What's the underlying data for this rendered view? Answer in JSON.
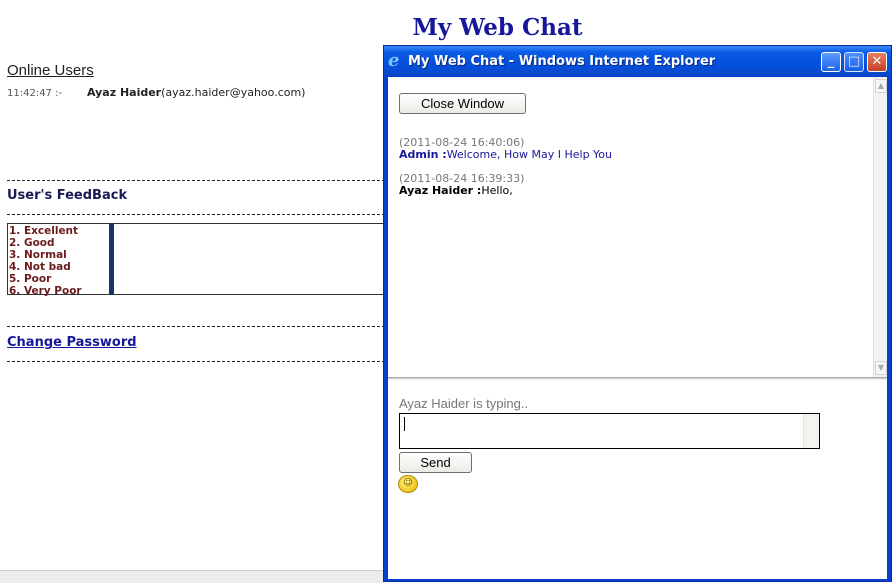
{
  "page": {
    "title": "My Web Chat"
  },
  "left": {
    "online_heading": "Online Users",
    "online_users": [
      {
        "time": "11:42:47 :-",
        "name": "Ayaz Haider",
        "email": "(ayaz.haider@yahoo.com)"
      }
    ],
    "feedback_heading": "User's FeedBack",
    "feedback_options": [
      "1. Excellent",
      "2. Good",
      "3. Normal",
      "4. Not bad",
      "5. Poor",
      "6. Very Poor"
    ],
    "change_password": "Change Password"
  },
  "window": {
    "title": "My Web Chat - Windows Internet Explorer",
    "min_glyph": "_",
    "max_glyph": "□",
    "close_glyph": "✕",
    "close_window_label": "Close Window",
    "messages": [
      {
        "timestamp": "(2011-08-24 16:40:06)",
        "sender": "Admin :",
        "text": "Welcome, How May I Help You"
      },
      {
        "timestamp": "(2011-08-24 16:39:33)",
        "sender": "Ayaz Haider :",
        "text": "Hello,"
      }
    ],
    "typing_status": "Ayaz Haider is typing..",
    "message_value": "",
    "send_label": "Send",
    "up_arrow": "▲",
    "down_arrow": "▼"
  },
  "icons": {
    "ie_logo": "e",
    "smiley": "☺"
  },
  "colors": {
    "title_blue": "#17179a",
    "feedback_red": "#6b1b1b",
    "titlebar_blue": "#0550dd"
  }
}
